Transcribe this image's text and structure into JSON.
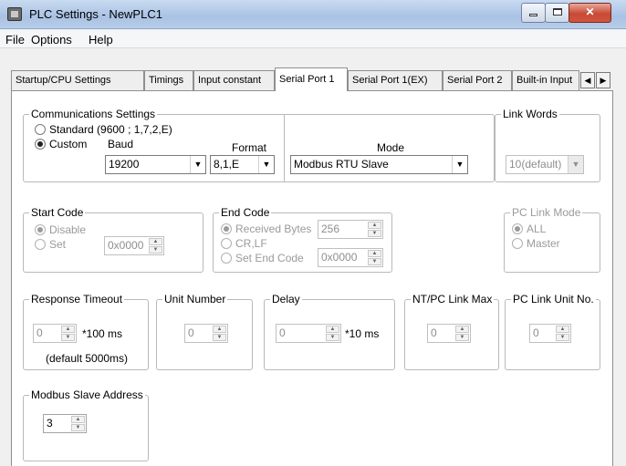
{
  "window": {
    "title": "PLC Settings - NewPLC1",
    "close_glyph": "✕"
  },
  "menu": [
    "File",
    "Options",
    "Help"
  ],
  "tabs": [
    "Startup/CPU Settings",
    "Timings",
    "Input constant",
    "Serial Port 1",
    "Serial Port 1(EX)",
    "Serial Port 2",
    "Built-in Input"
  ],
  "tab_scroll": {
    "left": "◀",
    "right": "▶"
  },
  "comm": {
    "legend": "Communications Settings",
    "standard_label": "Standard (9600 ; 1,7,2,E)",
    "custom_label": "Custom",
    "baud_label": "Baud",
    "baud_value": "19200",
    "format_label": "Format",
    "format_value": "8,1,E",
    "mode_label": "Mode",
    "mode_value": "Modbus RTU Slave",
    "selected": "Custom"
  },
  "link_words": {
    "legend": "Link Words",
    "value": "10(default)"
  },
  "start_code": {
    "legend": "Start Code",
    "disable_label": "Disable",
    "set_label": "Set",
    "value": "0x0000"
  },
  "end_code": {
    "legend": "End Code",
    "received_label": "Received Bytes",
    "received_value": "256",
    "crlf_label": "CR,LF",
    "set_end_label": "Set End Code",
    "set_end_value": "0x0000"
  },
  "pc_link_mode": {
    "legend": "PC Link Mode",
    "all_label": "ALL",
    "master_label": "Master"
  },
  "response_timeout": {
    "legend": "Response Timeout",
    "value": "0",
    "unit": "*100 ms",
    "note": "(default 5000ms)"
  },
  "unit_number": {
    "legend": "Unit Number",
    "value": "0"
  },
  "delay": {
    "legend": "Delay",
    "value": "0",
    "unit": "*10 ms"
  },
  "nt_pc_link_max": {
    "legend": "NT/PC Link Max",
    "value": "0"
  },
  "pc_link_unit_no": {
    "legend": "PC Link Unit No.",
    "value": "0"
  },
  "modbus_slave": {
    "legend": "Modbus Slave Address",
    "value": "3"
  },
  "glyphs": {
    "down": "▼",
    "up": "▲"
  }
}
